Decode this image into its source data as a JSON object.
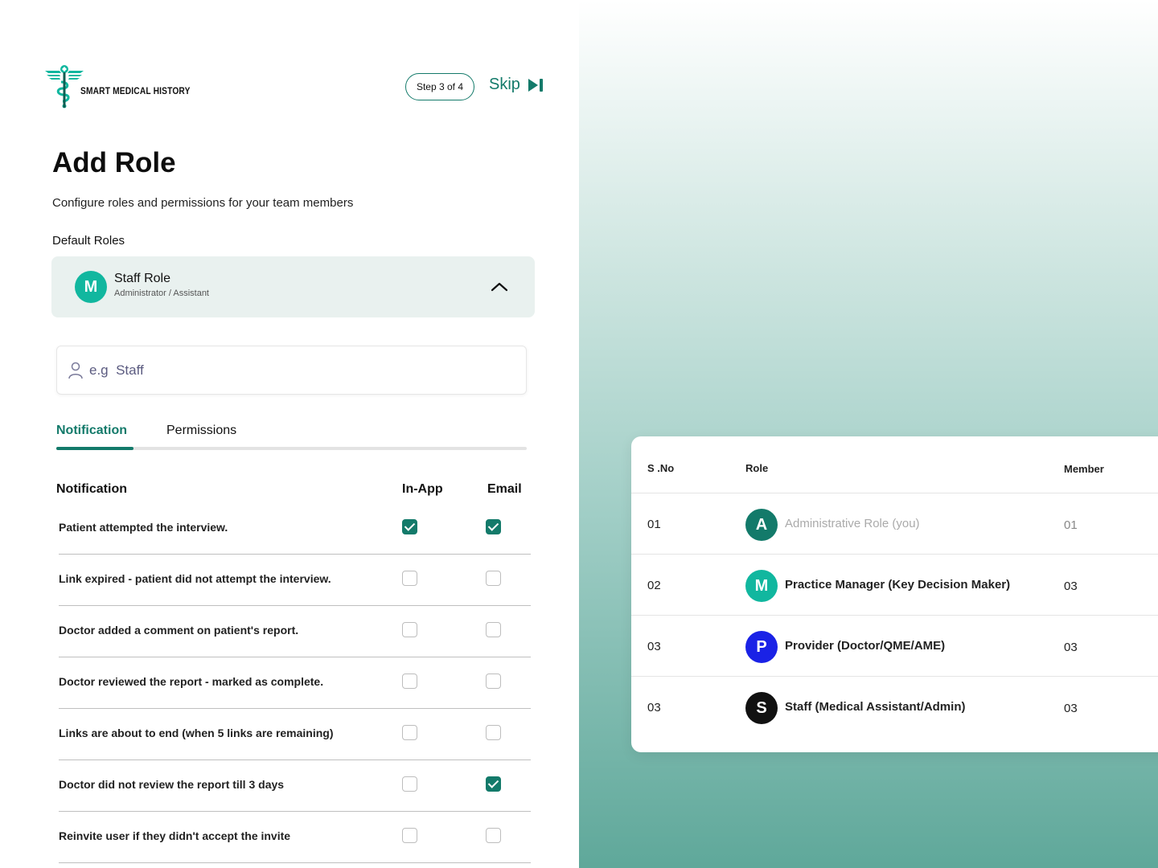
{
  "brand": {
    "name": "SMART MEDICAL HISTORY",
    "logo_icon": "caduceus-icon",
    "accent": "#137a6a",
    "logo_color": "#11b79f"
  },
  "header": {
    "step": "Step 3 of 4",
    "skip_label": "Skip",
    "skip_icon": "skip-next-icon"
  },
  "page": {
    "title": "Add Role",
    "subtitle": "Configure roles and permissions for your team members",
    "default_roles_label": "Default Roles"
  },
  "selected_role": {
    "initial": "M",
    "name": "Staff Role",
    "description": "Administrator / Assistant",
    "color": "#11b79f"
  },
  "role_input": {
    "prefix": "e.g",
    "placeholder": "Staff",
    "value": ""
  },
  "tabs": [
    {
      "label": "Notification",
      "active": true
    },
    {
      "label": "Permissions",
      "active": false
    }
  ],
  "notifications": {
    "headers": {
      "name": "Notification",
      "in_app": "In-App",
      "email": "Email"
    },
    "rows": [
      {
        "label": "Patient attempted the interview.",
        "in_app": true,
        "email": true
      },
      {
        "label": "Link expired - patient did not attempt the interview.",
        "in_app": false,
        "email": false
      },
      {
        "label": "Doctor added a comment on patient's report.",
        "in_app": false,
        "email": false
      },
      {
        "label": "Doctor reviewed the report - marked as complete.",
        "in_app": false,
        "email": false
      },
      {
        "label": "Links are about to end (when 5 links are remaining)",
        "in_app": false,
        "email": false
      },
      {
        "label": "Doctor did not review the report till 3 days",
        "in_app": false,
        "email": true
      },
      {
        "label": "Reinvite user if they didn't accept the invite",
        "in_app": false,
        "email": false
      }
    ]
  },
  "roles_table": {
    "headers": {
      "sno": "S .No",
      "role": "Role",
      "member": "Member"
    },
    "rows": [
      {
        "sno": "01",
        "initial": "A",
        "color": "#137a6a",
        "role": "Administrative Role (you)",
        "member": "01",
        "muted": true
      },
      {
        "sno": "02",
        "initial": "M",
        "color": "#11b79f",
        "role": "Practice Manager (Key Decision Maker)",
        "member": "03",
        "muted": false
      },
      {
        "sno": "03",
        "initial": "P",
        "color": "#1a22e6",
        "role": "Provider (Doctor/QME/AME)",
        "member": "03",
        "muted": false
      },
      {
        "sno": "03",
        "initial": "S",
        "color": "#111111",
        "role": "Staff (Medical Assistant/Admin)",
        "member": "03",
        "muted": false
      }
    ]
  }
}
